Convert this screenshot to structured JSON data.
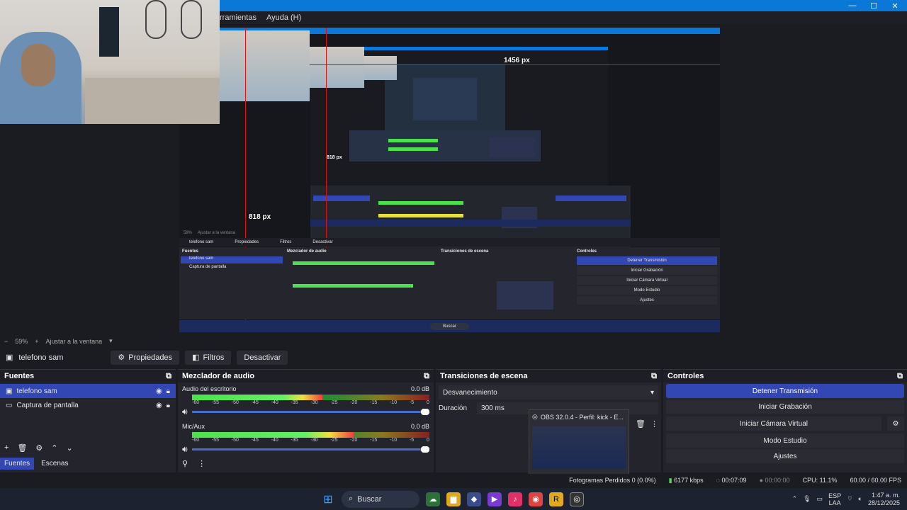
{
  "window": {
    "minimize": "—",
    "maximize": "☐",
    "close": "✕"
  },
  "menu": {
    "items": [
      "rramientas",
      "Ayuda (H)"
    ]
  },
  "preview": {
    "width_label": "1456 px",
    "height_label": "818 px",
    "small_height_label": "818 px",
    "nested_menu": [
      "ramientas",
      "Ayuda (H)"
    ],
    "nested_source_bar": [
      "telefono sam",
      "Propiedades",
      "Filtros",
      "Desactivar"
    ],
    "nested_docks": [
      "Fuentes",
      "Mezclador de audio",
      "Transiciones de escena",
      "Controles"
    ],
    "nested_sources": [
      "telefono sam",
      "Captura de pantalla"
    ],
    "nested_controls": [
      "Detener Transmisión",
      "Iniciar Grabación",
      "Iniciar Cámara Virtual",
      "Modo Estudio",
      "Ajustes"
    ],
    "nested_search": "Buscar",
    "nested_zoom": "59%",
    "nested_fit": "Ajustar a la ventana"
  },
  "zoom": {
    "level": "59%",
    "fit_label": "Ajustar a la ventana"
  },
  "source_toolbar": {
    "source_name": "telefono sam",
    "properties": "Propiedades",
    "filters": "Filtros",
    "deactivate": "Desactivar"
  },
  "sources": {
    "title": "Fuentes",
    "items": [
      {
        "label": "telefono sam"
      },
      {
        "label": "Captura de pantalla"
      }
    ],
    "tabs": [
      "Fuentes",
      "Escenas"
    ]
  },
  "mixer": {
    "title": "Mezclador de audio",
    "channels": [
      {
        "name": "Audio del escritorio",
        "db": "0.0 dB",
        "level": 0.55
      },
      {
        "name": "Mic/Aux",
        "db": "0.0 dB",
        "level": 0.68
      }
    ],
    "ticks": [
      "-60",
      "-55",
      "-50",
      "-45",
      "-40",
      "-35",
      "-30",
      "-25",
      "-20",
      "-15",
      "-10",
      "-5",
      "0"
    ]
  },
  "transitions": {
    "title": "Transiciones de escena",
    "selected": "Desvanecimiento",
    "duration_label": "Duración",
    "duration_value": "300 ms"
  },
  "tooltip": {
    "title": "OBS 32.0.4 - Perfil: kick - E..."
  },
  "controls": {
    "title": "Controles",
    "stop_stream": "Detener Transmisión",
    "start_record": "Iniciar Grabación",
    "start_vcam": "Iniciar Cámara Virtual",
    "studio_mode": "Modo Estudio",
    "settings": "Ajustes"
  },
  "status": {
    "dropped": "Fotogramas Perdidos 0 (0.0%)",
    "bitrate": "6177 kbps",
    "stream_time": "00:07:09",
    "rec_time": "00:00:00",
    "cpu": "CPU: 11.1%",
    "fps": "60.00 / 60.00 FPS"
  },
  "taskbar": {
    "search": "Buscar",
    "lang1": "ESP",
    "lang2": "LAA",
    "time": "1:47 a. m.",
    "date": "28/12/2025"
  },
  "colors": {
    "accent": "#3246b4",
    "titlebar": "#0a78d7",
    "guide": "#dd1111"
  }
}
